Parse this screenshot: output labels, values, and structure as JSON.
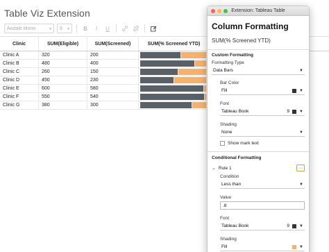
{
  "app": {
    "title": "Table Viz Extension",
    "font_select": "Andale Mono",
    "size_select": "9"
  },
  "toolbar_icons": [
    "bold-icon",
    "italic-icon",
    "underline-icon",
    "link-icon",
    "unlink-icon",
    "edit-icon"
  ],
  "table": {
    "headers": [
      "Clinic",
      "SUM(Eligible)",
      "SUM(Screened)",
      "SUM(% Screened YTD)"
    ],
    "rows": [
      {
        "clinic": "Clinic A",
        "eligible": "320",
        "screened": "200",
        "pct": 0.625
      },
      {
        "clinic": "Clinic B",
        "eligible": "480",
        "screened": "400",
        "pct": 0.833
      },
      {
        "clinic": "Clinic C",
        "eligible": "260",
        "screened": "150",
        "pct": 0.577
      },
      {
        "clinic": "Clinic D",
        "eligible": "450",
        "screened": "230",
        "pct": 0.511
      },
      {
        "clinic": "Clinic E",
        "eligible": "600",
        "screened": "580",
        "pct": 0.967
      },
      {
        "clinic": "Clinic F",
        "eligible": "550",
        "screened": "540",
        "pct": 0.982
      },
      {
        "clinic": "Clinic G",
        "eligible": "380",
        "screened": "300",
        "pct": 0.789
      }
    ],
    "bar_color": "#5a6068",
    "bar_remainder_color": "#f6b26b"
  },
  "ext": {
    "window_title": "Extension: Tableau Table",
    "heading": "Column Formatting",
    "column_name": "SUM(% Screened YTD)",
    "custom_section": "Custom Formatting",
    "formatting_type_label": "Formatting Type",
    "formatting_type_value": "Data Bars",
    "bar_color_label": "Bar Color",
    "bar_color_value": "Fill",
    "font_label": "Font",
    "font_value": "Tableau Book",
    "font_size": "9",
    "shading_label": "Shading",
    "shading_value": "None",
    "show_mark_text": "Show mark text",
    "conditional_section": "Conditional Formatting",
    "rule_label": "Rule 1",
    "more_glyph": "···",
    "condition_label": "Condition",
    "condition_value": "Less than",
    "value_label": "Value",
    "value_value": ".8",
    "rule_font_label": "Font",
    "rule_font_value": "Tableau Book",
    "rule_font_size": "9",
    "rule_shading_label": "Shading",
    "rule_shading_value": "Fill",
    "rule_shading_color": "#f6b26b"
  }
}
